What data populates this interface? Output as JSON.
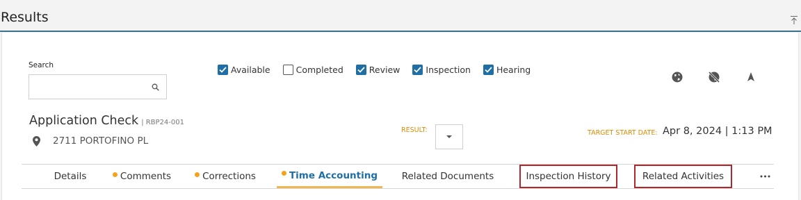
{
  "header": {
    "title": "Results"
  },
  "search": {
    "label": "Search",
    "value": "",
    "placeholder": ""
  },
  "filters": [
    {
      "label": "Available",
      "checked": true
    },
    {
      "label": "Completed",
      "checked": false
    },
    {
      "label": "Review",
      "checked": true
    },
    {
      "label": "Inspection",
      "checked": true
    },
    {
      "label": "Hearing",
      "checked": true
    }
  ],
  "map_icons": [
    "globe-icon",
    "globe-off-icon",
    "navigation-arrow-icon"
  ],
  "record": {
    "title": "Application Check",
    "id": "| RBP24-001",
    "address": "2711 PORTOFINO PL",
    "result_label": "RESULT:",
    "target_label": "TARGET START DATE:",
    "target_value": "Apr 8, 2024 | 1:13 PM"
  },
  "tabs": [
    {
      "label": "Details",
      "dot": false
    },
    {
      "label": "Comments",
      "dot": true
    },
    {
      "label": "Corrections",
      "dot": true
    },
    {
      "label": "Time Accounting",
      "dot": true,
      "active": true
    },
    {
      "label": "Related Documents",
      "dot": false
    },
    {
      "label": "Inspection History",
      "dot": false,
      "highlighted": true
    },
    {
      "label": "Related Activities",
      "dot": false,
      "highlighted": true
    }
  ],
  "colors": {
    "accent": "#1f6fa6",
    "orange": "#f2a31b",
    "highlight_border": "#b3262a",
    "header_rule": "#3c6e8f"
  }
}
